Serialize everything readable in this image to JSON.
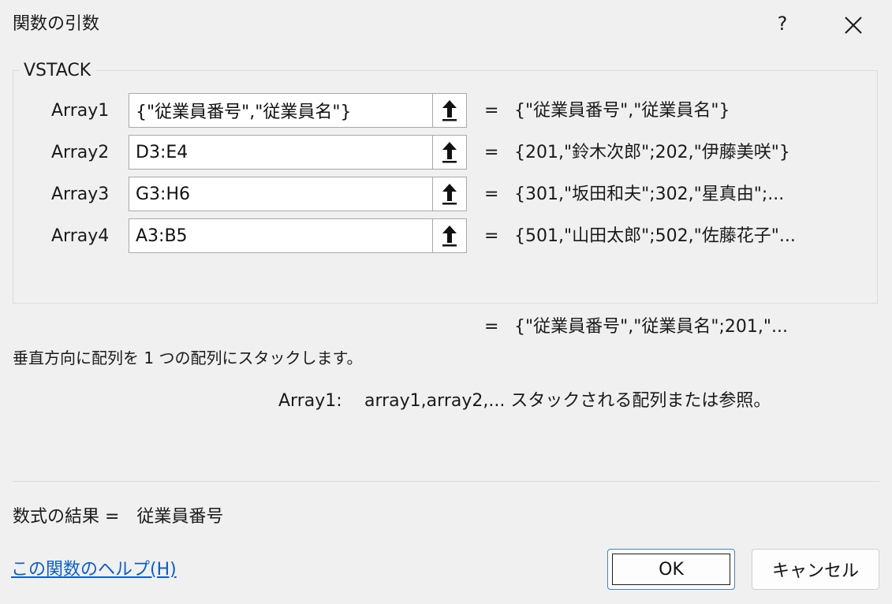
{
  "window": {
    "title": "関数の引数",
    "help_label": "?"
  },
  "function": {
    "name": "VSTACK",
    "description": "垂直方向に配列を 1 つの配列にスタックします。",
    "result_eq": "=",
    "result_value": "{\"従業員番号\",\"従業員名\";201,\"..."
  },
  "arguments": [
    {
      "label": "Array1",
      "input": "{\"従業員番号\",\"従業員名\"}",
      "eq": "=",
      "value": "{\"従業員番号\",\"従業員名\"}"
    },
    {
      "label": "Array2",
      "input": "D3:E4",
      "eq": "=",
      "value": "{201,\"鈴木次郎\";202,\"伊藤美咲\"}"
    },
    {
      "label": "Array3",
      "input": "G3:H6",
      "eq": "=",
      "value": "{301,\"坂田和夫\";302,\"星真由\";..."
    },
    {
      "label": "Array4",
      "input": "A3:B5",
      "eq": "=",
      "value": "{501,\"山田太郎\";502,\"佐藤花子\"..."
    }
  ],
  "arg_help": {
    "name": "Array1:",
    "text": "array1,array2,... スタックされる配列または参照。"
  },
  "formula_result": "数式の結果 =　従業員番号",
  "help_link": "この関数のヘルプ(H)",
  "buttons": {
    "ok": "OK",
    "cancel": "キャンセル"
  },
  "colors": {
    "background": "#f0f0f0",
    "link": "#0b5ec9",
    "ok_border": "#4a7fc4"
  }
}
